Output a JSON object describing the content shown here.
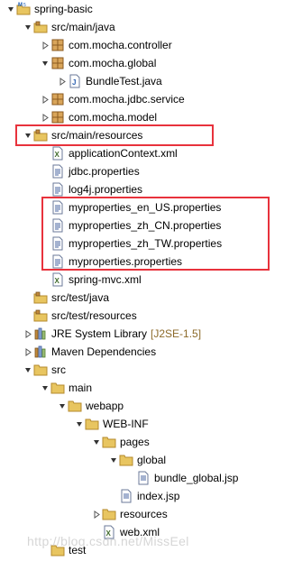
{
  "tree": [
    {
      "label": "spring-basic",
      "icon": "maven-project-icon",
      "twisty": "expanded",
      "depth": 0
    },
    {
      "label": "src/main/java",
      "icon": "source-folder-icon",
      "twisty": "expanded",
      "depth": 1
    },
    {
      "label": "com.mocha.controller",
      "icon": "package-icon",
      "twisty": "collapsed",
      "depth": 2
    },
    {
      "label": "com.mocha.global",
      "icon": "package-icon",
      "twisty": "expanded",
      "depth": 2
    },
    {
      "label": "BundleTest.java",
      "icon": "java-file-icon",
      "twisty": "collapsed",
      "depth": 3
    },
    {
      "label": "com.mocha.jdbc.service",
      "icon": "package-icon",
      "twisty": "collapsed",
      "depth": 2
    },
    {
      "label": "com.mocha.model",
      "icon": "package-icon",
      "twisty": "collapsed",
      "depth": 2
    },
    {
      "label": "src/main/resources",
      "icon": "source-folder-icon",
      "twisty": "expanded",
      "depth": 1
    },
    {
      "label": "applicationContext.xml",
      "icon": "xml-file-icon",
      "twisty": "none",
      "depth": 2
    },
    {
      "label": "jdbc.properties",
      "icon": "properties-file-icon",
      "twisty": "none",
      "depth": 2
    },
    {
      "label": "log4j.properties",
      "icon": "properties-file-icon",
      "twisty": "none",
      "depth": 2
    },
    {
      "label": "myproperties_en_US.properties",
      "icon": "properties-file-icon",
      "twisty": "none",
      "depth": 2
    },
    {
      "label": "myproperties_zh_CN.properties",
      "icon": "properties-file-icon",
      "twisty": "none",
      "depth": 2
    },
    {
      "label": "myproperties_zh_TW.properties",
      "icon": "properties-file-icon",
      "twisty": "none",
      "depth": 2
    },
    {
      "label": "myproperties.properties",
      "icon": "properties-file-icon",
      "twisty": "none",
      "depth": 2
    },
    {
      "label": "spring-mvc.xml",
      "icon": "xml-file-icon",
      "twisty": "none",
      "depth": 2
    },
    {
      "label": "src/test/java",
      "icon": "source-folder-icon",
      "twisty": "none",
      "depth": 1
    },
    {
      "label": "src/test/resources",
      "icon": "source-folder-icon",
      "twisty": "none",
      "depth": 1
    },
    {
      "label": "JRE System Library",
      "suffix": "[J2SE-1.5]",
      "icon": "library-icon",
      "twisty": "collapsed",
      "depth": 1
    },
    {
      "label": "Maven Dependencies",
      "icon": "library-icon",
      "twisty": "collapsed",
      "depth": 1
    },
    {
      "label": "src",
      "icon": "folder-icon",
      "twisty": "expanded",
      "depth": 1
    },
    {
      "label": "main",
      "icon": "folder-icon",
      "twisty": "expanded",
      "depth": 2
    },
    {
      "label": "webapp",
      "icon": "folder-icon",
      "twisty": "expanded",
      "depth": 3
    },
    {
      "label": "WEB-INF",
      "icon": "folder-icon",
      "twisty": "expanded",
      "depth": 4
    },
    {
      "label": "pages",
      "icon": "folder-icon",
      "twisty": "expanded",
      "depth": 5
    },
    {
      "label": "global",
      "icon": "folder-icon",
      "twisty": "expanded",
      "depth": 6
    },
    {
      "label": "bundle_global.jsp",
      "icon": "jsp-file-icon",
      "twisty": "none",
      "depth": 7
    },
    {
      "label": "index.jsp",
      "icon": "jsp-file-icon",
      "twisty": "none",
      "depth": 6
    },
    {
      "label": "resources",
      "icon": "folder-icon",
      "twisty": "collapsed",
      "depth": 5
    },
    {
      "label": "web.xml",
      "icon": "xml-file-icon",
      "twisty": "none",
      "depth": 5
    },
    {
      "label": "test",
      "icon": "folder-icon",
      "twisty": "none",
      "depth": 2
    }
  ],
  "watermark": "http://blog.csdn.net/MissEel",
  "colors": {
    "highlight": "#e8323c",
    "folder": "#e8c560",
    "package": "#c28a3c",
    "suffix": "#8c6a2a"
  }
}
